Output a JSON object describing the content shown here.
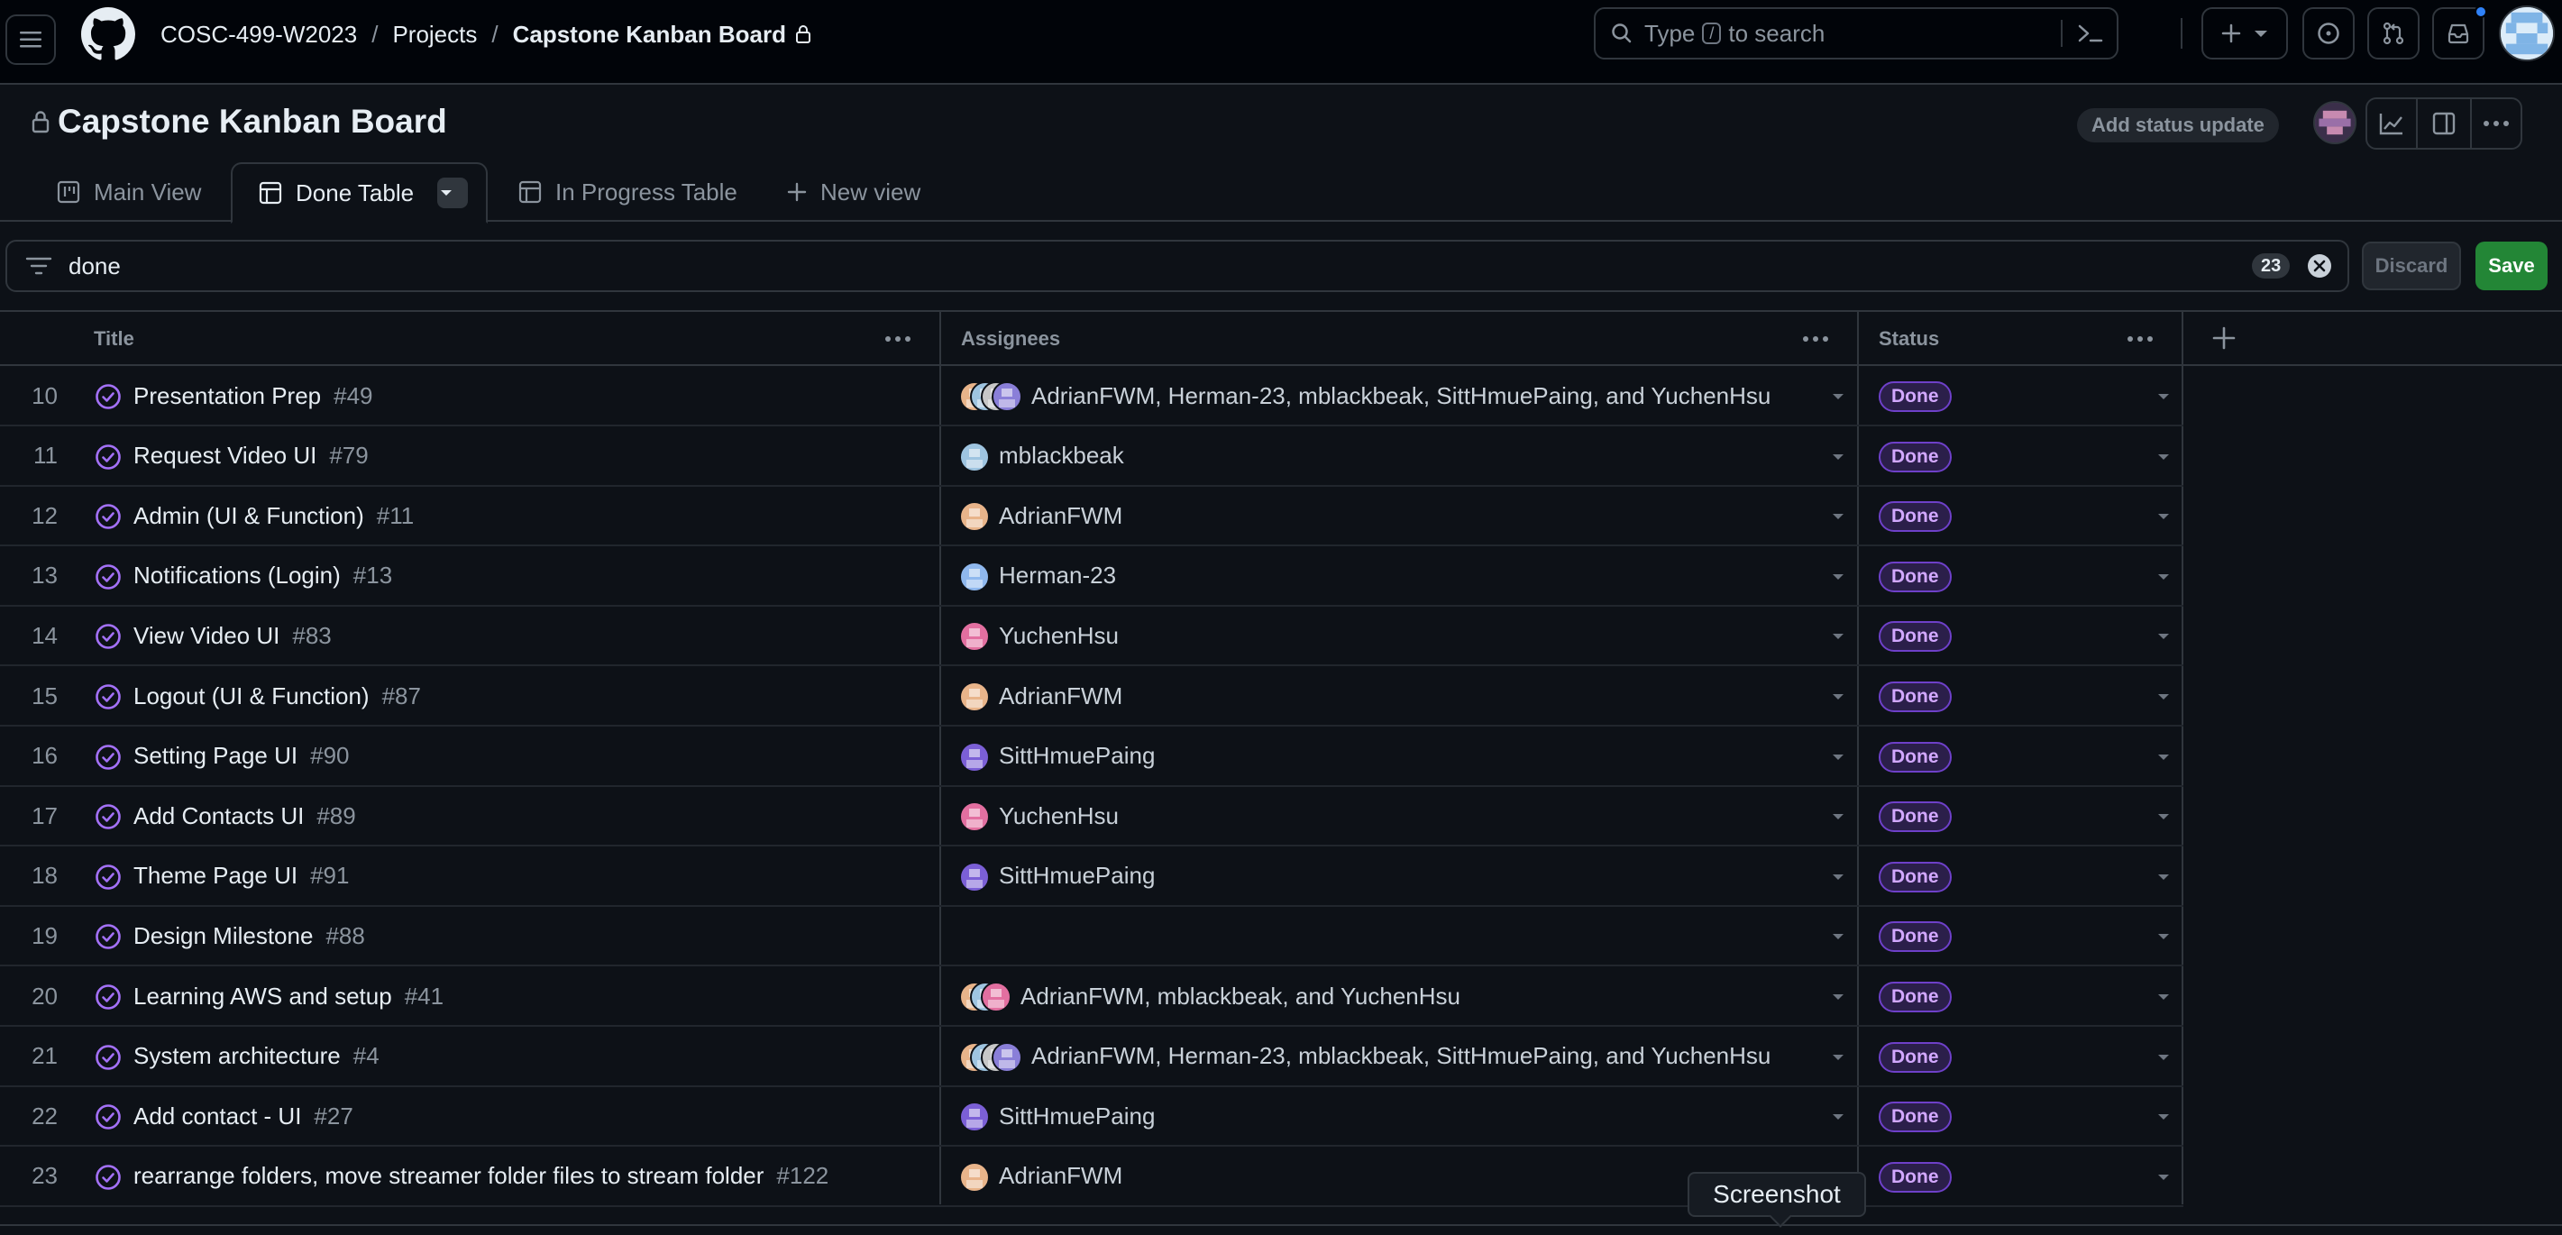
{
  "header": {
    "breadcrumbs": [
      "COSC-499-W2023",
      "Projects",
      "Capstone Kanban Board"
    ],
    "search_prefix": "Type",
    "search_key": "/",
    "search_suffix": "to search"
  },
  "project": {
    "title": "Capstone Kanban Board",
    "status_button": "Add status update"
  },
  "tabs": [
    {
      "label": "Main View",
      "icon": "board-icon"
    },
    {
      "label": "Done Table",
      "icon": "table-icon",
      "active": true
    },
    {
      "label": "In Progress Table",
      "icon": "table-icon"
    },
    {
      "label": "New view",
      "icon": "plus-icon"
    }
  ],
  "filter": {
    "query": "done",
    "count": "23",
    "discard": "Discard",
    "save": "Save"
  },
  "table": {
    "columns": [
      "Title",
      "Assignees",
      "Status"
    ],
    "rows": [
      {
        "n": "10",
        "title": "Presentation Prep",
        "num": "#49",
        "assignees": "AdrianFWM, Herman-23, mblackbeak, SittHmuePaing, and YuchenHsu",
        "avatars": [
          "#e8b48a",
          "#9ec4e0",
          "#c7c7c7",
          "#8a7fd8"
        ],
        "status": "Done"
      },
      {
        "n": "11",
        "title": "Request Video UI",
        "num": "#79",
        "assignees": "mblackbeak",
        "avatars": [
          "#9ec4e0"
        ],
        "status": "Done"
      },
      {
        "n": "12",
        "title": "Admin (UI & Function)",
        "num": "#11",
        "assignees": "AdrianFWM",
        "avatars": [
          "#e8b48a"
        ],
        "status": "Done"
      },
      {
        "n": "13",
        "title": "Notifications (Login)",
        "num": "#13",
        "assignees": "Herman-23",
        "avatars": [
          "#8fb8ee"
        ],
        "status": "Done"
      },
      {
        "n": "14",
        "title": "View Video UI",
        "num": "#83",
        "assignees": "YuchenHsu",
        "avatars": [
          "#e26fa0"
        ],
        "status": "Done"
      },
      {
        "n": "15",
        "title": "Logout (UI & Function)",
        "num": "#87",
        "assignees": "AdrianFWM",
        "avatars": [
          "#e8b48a"
        ],
        "status": "Done"
      },
      {
        "n": "16",
        "title": "Setting Page UI",
        "num": "#90",
        "assignees": "SittHmuePaing",
        "avatars": [
          "#7b5fd6"
        ],
        "status": "Done"
      },
      {
        "n": "17",
        "title": "Add Contacts UI",
        "num": "#89",
        "assignees": "YuchenHsu",
        "avatars": [
          "#e26fa0"
        ],
        "status": "Done"
      },
      {
        "n": "18",
        "title": "Theme Page UI",
        "num": "#91",
        "assignees": "SittHmuePaing",
        "avatars": [
          "#7b5fd6"
        ],
        "status": "Done"
      },
      {
        "n": "19",
        "title": "Design Milestone",
        "num": "#88",
        "assignees": "",
        "avatars": [],
        "status": "Done"
      },
      {
        "n": "20",
        "title": "Learning AWS and setup",
        "num": "#41",
        "assignees": "AdrianFWM, mblackbeak, and YuchenHsu",
        "avatars": [
          "#e8b48a",
          "#9ec4e0",
          "#e26fa0"
        ],
        "status": "Done"
      },
      {
        "n": "21",
        "title": "System architecture",
        "num": "#4",
        "assignees": "AdrianFWM, Herman-23, mblackbeak, SittHmuePaing, and YuchenHsu",
        "avatars": [
          "#e8b48a",
          "#9ec4e0",
          "#c7c7c7",
          "#8a7fd8"
        ],
        "status": "Done"
      },
      {
        "n": "22",
        "title": "Add contact - UI",
        "num": "#27",
        "assignees": "SittHmuePaing",
        "avatars": [
          "#7b5fd6"
        ],
        "status": "Done"
      },
      {
        "n": "23",
        "title": "rearrange folders, move streamer folder files to stream folder",
        "num": "#122",
        "assignees": "AdrianFWM",
        "avatars": [
          "#e8b48a"
        ],
        "status": "Done"
      }
    ]
  },
  "tooltip": "Screenshot",
  "colors": {
    "background": "#0d1117",
    "border": "#30363d",
    "done_badge": "#d2a8ff",
    "accent_purple": "#a371f7",
    "save_green": "#238636"
  }
}
